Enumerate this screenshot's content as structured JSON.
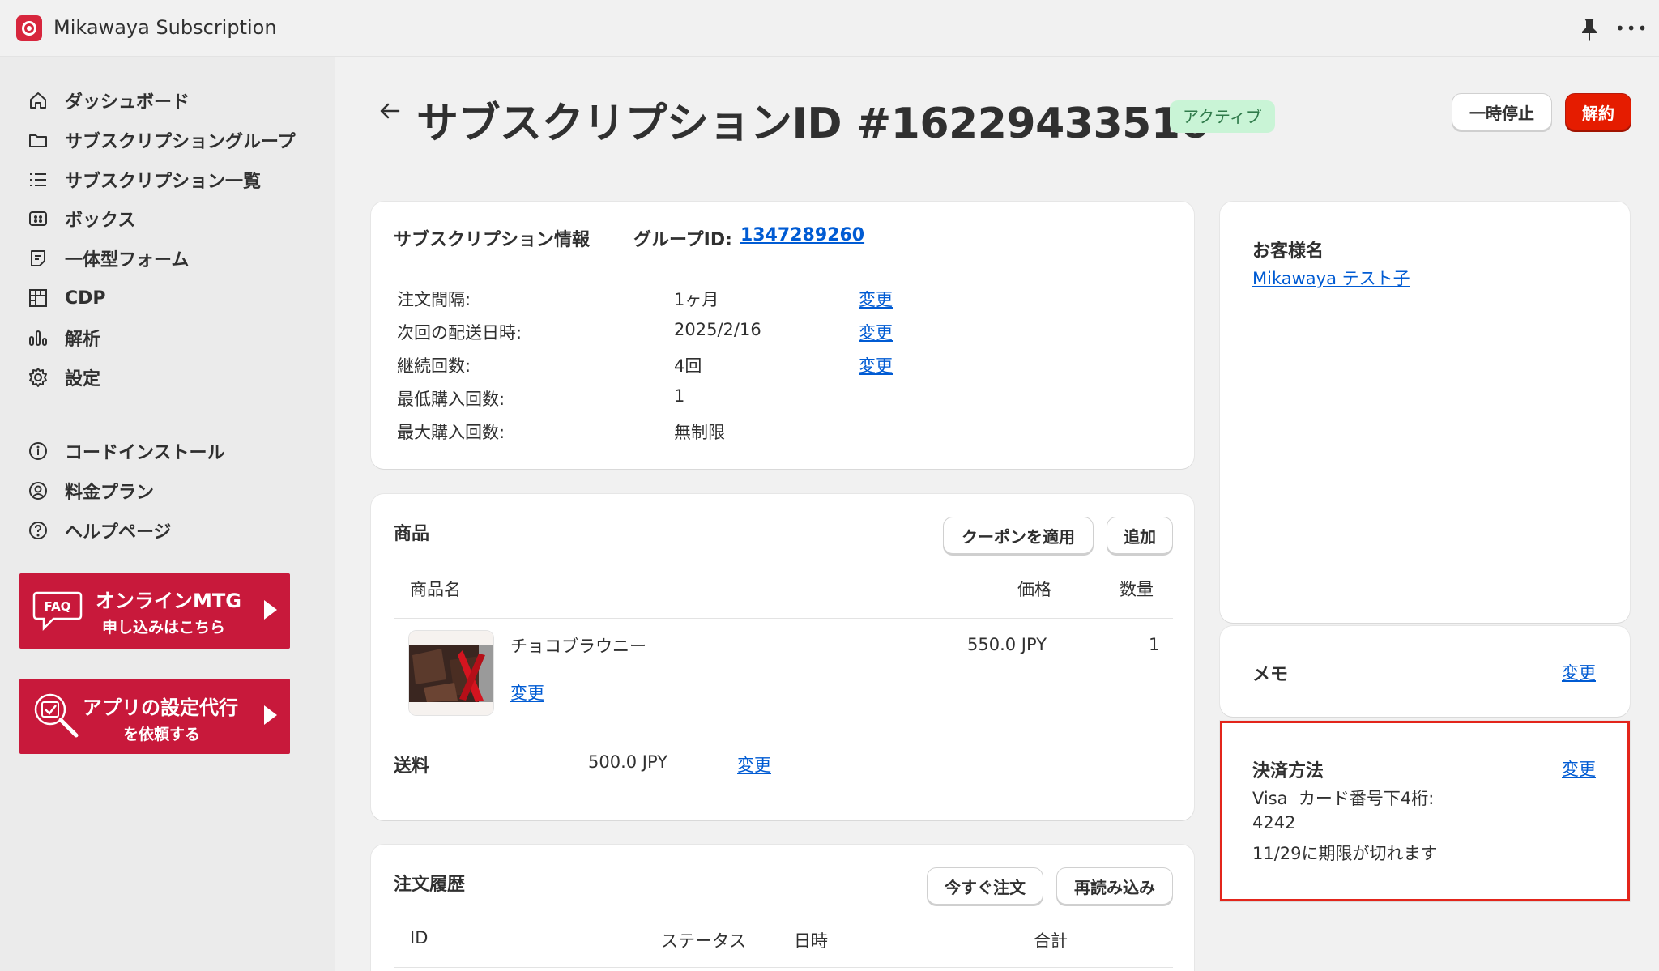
{
  "app": {
    "title": "Mikawaya Subscription"
  },
  "sidebar": {
    "items": [
      {
        "label": "ダッシュボード",
        "icon": "home-icon"
      },
      {
        "label": "サブスクリプショングループ",
        "icon": "folder-icon"
      },
      {
        "label": "サブスクリプション一覧",
        "icon": "list-icon"
      },
      {
        "label": "ボックス",
        "icon": "box-icon"
      },
      {
        "label": "一体型フォーム",
        "icon": "form-icon"
      },
      {
        "label": "CDP",
        "icon": "grid-icon"
      },
      {
        "label": "解析",
        "icon": "analytics-icon"
      },
      {
        "label": "設定",
        "icon": "gear-icon"
      },
      {
        "label": "コードインストール",
        "icon": "info-icon"
      },
      {
        "label": "料金プラン",
        "icon": "user-circle-icon"
      },
      {
        "label": "ヘルプページ",
        "icon": "help-icon"
      }
    ],
    "promo1": {
      "line1": "オンラインMTG",
      "line2": "申し込みはこちら",
      "badge": "FAQ"
    },
    "promo2": {
      "line1": "アプリの設定代行",
      "line2": "を依頼する"
    }
  },
  "header": {
    "title": "サブスクリプションID #16229433516",
    "status": "アクティブ",
    "pause_label": "一時停止",
    "cancel_label": "解約"
  },
  "info": {
    "heading": "サブスクリプション情報",
    "group_label": "グループID:",
    "group_id": "1347289260",
    "rows": [
      {
        "label": "注文間隔:",
        "value": "1ヶ月",
        "action": "変更"
      },
      {
        "label": "次回の配送日時:",
        "value": "2025/2/16",
        "action": "変更"
      },
      {
        "label": "継続回数:",
        "value": "4回",
        "action": "変更"
      },
      {
        "label": "最低購入回数:",
        "value": "1",
        "action": ""
      },
      {
        "label": "最大購入回数:",
        "value": "無制限",
        "action": ""
      }
    ]
  },
  "products": {
    "heading": "商品",
    "coupon_label": "クーポンを適用",
    "add_label": "追加",
    "col_name": "商品名",
    "col_price": "価格",
    "col_qty": "数量",
    "item": {
      "name": "チョコブラウニー",
      "price": "550.0 JPY",
      "qty": "1",
      "action": "変更"
    },
    "shipping_label": "送料",
    "shipping_value": "500.0 JPY",
    "shipping_action": "変更"
  },
  "history": {
    "heading": "注文履歴",
    "order_now_label": "今すぐ注文",
    "reload_label": "再読み込み",
    "col_id": "ID",
    "col_status": "ステータス",
    "col_date": "日時",
    "col_total": "合計"
  },
  "customer": {
    "heading": "お客様名",
    "name": "Mikawaya テスト子"
  },
  "memo": {
    "heading": "メモ",
    "action": "変更"
  },
  "payment": {
    "heading": "決済方法",
    "action": "変更",
    "line1": "Visa  カード番号下4桁:",
    "line2": "4242",
    "line3": "11/29に期限が切れます"
  }
}
